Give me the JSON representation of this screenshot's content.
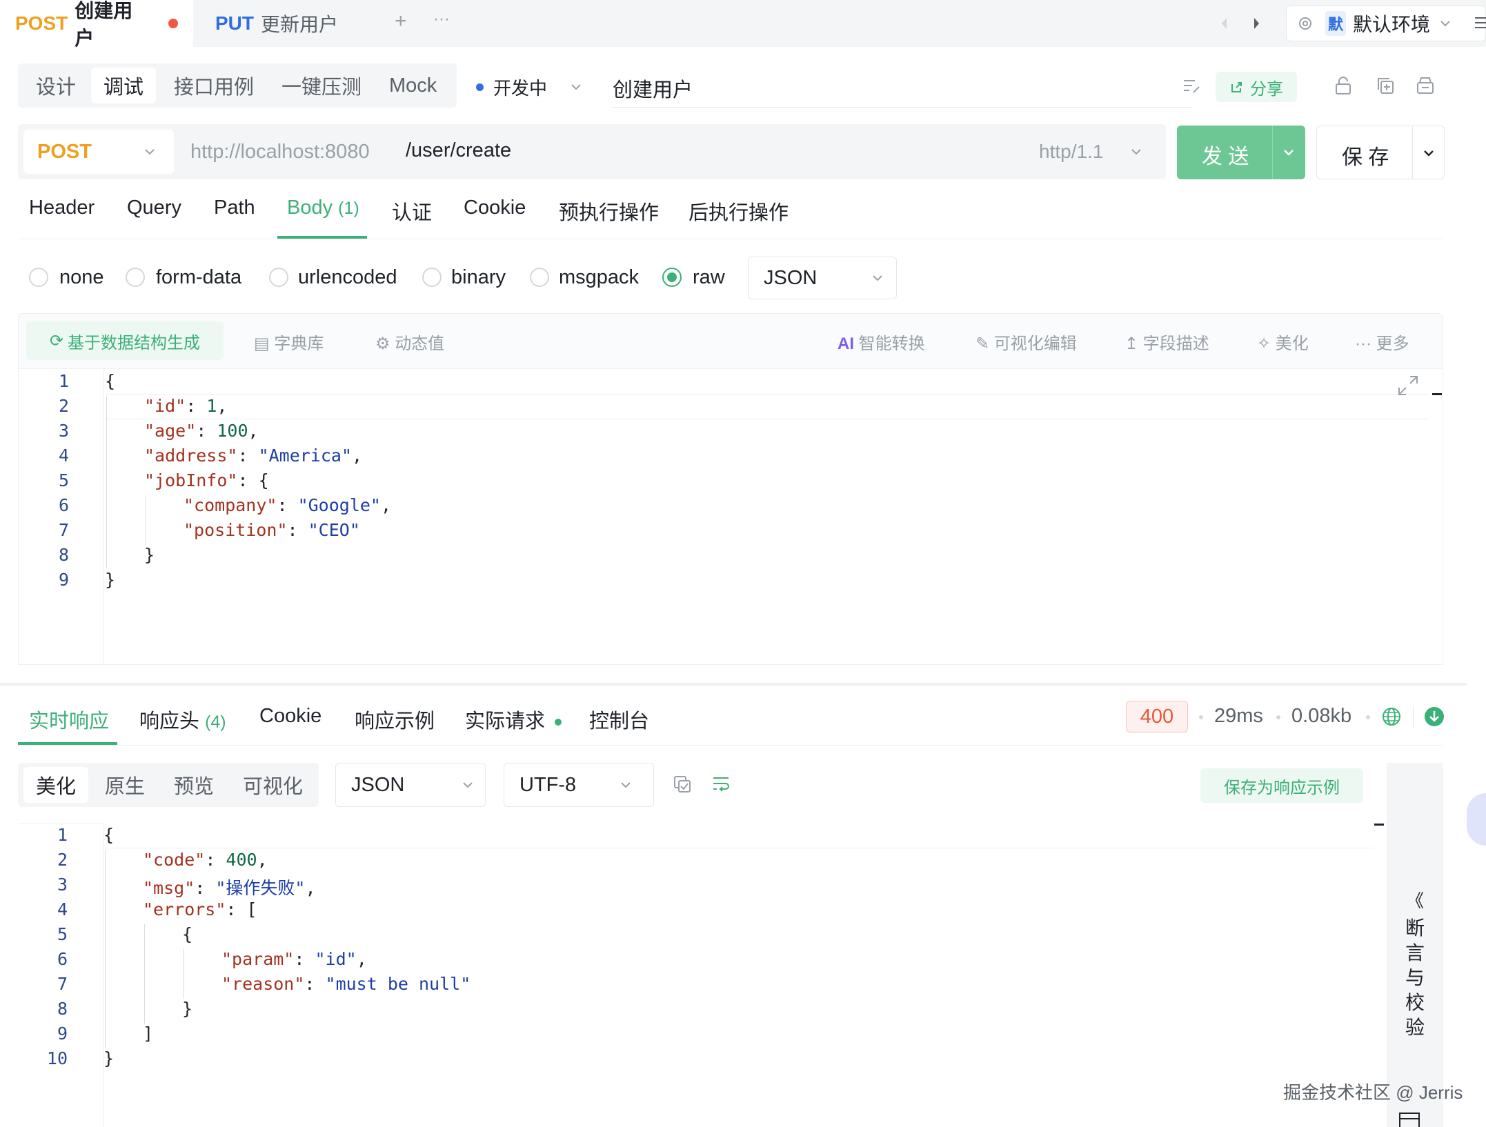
{
  "tabs": [
    {
      "method": "POST",
      "name": "创建用户"
    },
    {
      "method": "PUT",
      "name": "更新用户"
    }
  ],
  "tabbar": {
    "add": "+",
    "more": "···"
  },
  "environment": {
    "badge": "默",
    "name": "默认环境"
  },
  "modes": [
    "设计",
    "调试",
    "接口用例",
    "一键压测",
    "Mock"
  ],
  "status": {
    "label": "开发中"
  },
  "api_title": "创建用户",
  "header_actions": {
    "share": "分享"
  },
  "request": {
    "method": "POST",
    "base_url": "http://localhost:8080",
    "path": "/user/create",
    "protocol": "http/1.1",
    "send": "发 送",
    "save": "保 存"
  },
  "param_tabs": [
    {
      "label": "Header",
      "count": ""
    },
    {
      "label": "Query",
      "count": ""
    },
    {
      "label": "Path",
      "count": ""
    },
    {
      "label": "Body",
      "count": "(1)"
    },
    {
      "label": "认证",
      "count": ""
    },
    {
      "label": "Cookie",
      "count": ""
    },
    {
      "label": "预执行操作",
      "count": ""
    },
    {
      "label": "后执行操作",
      "count": ""
    }
  ],
  "body_types": [
    "none",
    "form-data",
    "urlencoded",
    "binary",
    "msgpack",
    "raw"
  ],
  "body_format": "JSON",
  "editor_toolbar": {
    "generate": "基于数据结构生成",
    "dict": "字典库",
    "dynamic": "动态值",
    "ai_badge": "AI",
    "ai": "智能转换",
    "visual": "可视化编辑",
    "field_desc": "字段描述",
    "beautify": "美化",
    "more": "更多"
  },
  "request_body_lines": [
    "1",
    "2",
    "3",
    "4",
    "5",
    "6",
    "7",
    "8",
    "9"
  ],
  "request_body": {
    "open": "{",
    "id_key": "\"id\"",
    "id_val": "1",
    "age_key": "\"age\"",
    "age_val": "100",
    "address_key": "\"address\"",
    "address_val": "\"America\"",
    "jobinfo_key": "\"jobInfo\"",
    "company_key": "\"company\"",
    "company_val": "\"Google\"",
    "position_key": "\"position\"",
    "position_val": "\"CEO\"",
    "inner_close": "}",
    "close": "}"
  },
  "response_tabs": [
    {
      "label": "实时响应",
      "count": ""
    },
    {
      "label": "响应头",
      "count": "(4)"
    },
    {
      "label": "Cookie",
      "count": ""
    },
    {
      "label": "响应示例",
      "count": ""
    },
    {
      "label": "实际请求",
      "count": ""
    },
    {
      "label": "控制台",
      "count": ""
    }
  ],
  "response_meta": {
    "status": "400",
    "time": "29ms",
    "size": "0.08kb"
  },
  "response_views": [
    "美化",
    "原生",
    "预览",
    "可视化"
  ],
  "response_format": "JSON",
  "response_encoding": "UTF-8",
  "save_as_sample": "保存为响应示例",
  "response_body_lines": [
    "1",
    "2",
    "3",
    "4",
    "5",
    "6",
    "7",
    "8",
    "9",
    "10"
  ],
  "response_body": {
    "open": "{",
    "code_key": "\"code\"",
    "code_val": "400",
    "msg_key": "\"msg\"",
    "msg_val": "\"操作失败\"",
    "errors_key": "\"errors\"",
    "arr_open": "[",
    "obj_open": "{",
    "param_key": "\"param\"",
    "param_val": "\"id\"",
    "reason_key": "\"reason\"",
    "reason_val": "\"must be null\"",
    "obj_close": "}",
    "arr_close": "]",
    "close": "}"
  },
  "side_panel": {
    "chevron": "《",
    "label": "断言与校验"
  },
  "watermark": "掘金技术社区 @ Jerris",
  "colors": {
    "accent": "#3bb077",
    "send": "#6cc795",
    "post": "#f0a020",
    "put": "#2f6fe0",
    "error": "#e55a3c"
  }
}
